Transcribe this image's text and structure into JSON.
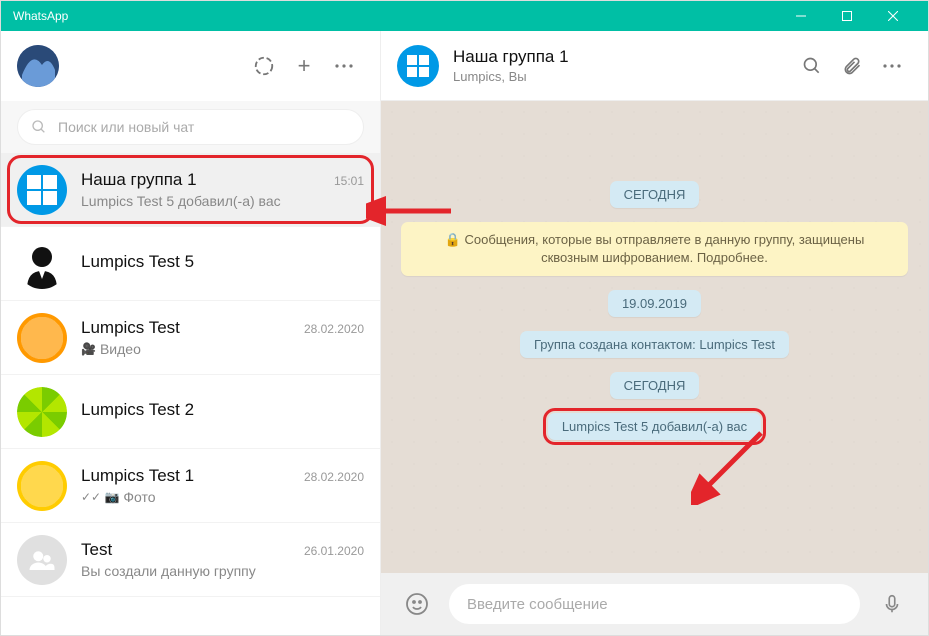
{
  "window": {
    "title": "WhatsApp"
  },
  "sidebar": {
    "search_placeholder": "Поиск или новый чат",
    "chats": [
      {
        "name": "Наша группа 1",
        "time": "15:01",
        "preview": "Lumpics Test 5 добавил(-а) вас",
        "selected": true,
        "avatar": "win",
        "highlighted": true
      },
      {
        "name": "Lumpics Test 5",
        "time": "",
        "preview": "",
        "avatar": "suit"
      },
      {
        "name": "Lumpics Test",
        "time": "28.02.2020",
        "preview": "Видео",
        "preview_icon": "video",
        "avatar": "orange"
      },
      {
        "name": "Lumpics Test 2",
        "time": "",
        "preview": "",
        "avatar": "green"
      },
      {
        "name": "Lumpics Test 1",
        "time": "28.02.2020",
        "preview": "Фото",
        "preview_icon": "photo_check",
        "avatar": "yellow"
      },
      {
        "name": "Test",
        "time": "26.01.2020",
        "preview": "Вы создали данную группу",
        "avatar": "group"
      }
    ]
  },
  "conversation": {
    "title": "Наша группа 1",
    "subtitle": "Lumpics, Вы",
    "messages": [
      {
        "type": "date",
        "text": "СЕГОДНЯ"
      },
      {
        "type": "notice",
        "text": "🔒 Сообщения, которые вы отправляете в данную группу, защищены сквозным шифрованием. Подробнее."
      },
      {
        "type": "date",
        "text": "19.09.2019"
      },
      {
        "type": "system",
        "text": "Группа создана контактом: Lumpics Test"
      },
      {
        "type": "date",
        "text": "СЕГОДНЯ"
      },
      {
        "type": "system",
        "text": "Lumpics Test 5 добавил(-а) вас",
        "highlighted": true
      }
    ],
    "composer_placeholder": "Введите сообщение"
  }
}
